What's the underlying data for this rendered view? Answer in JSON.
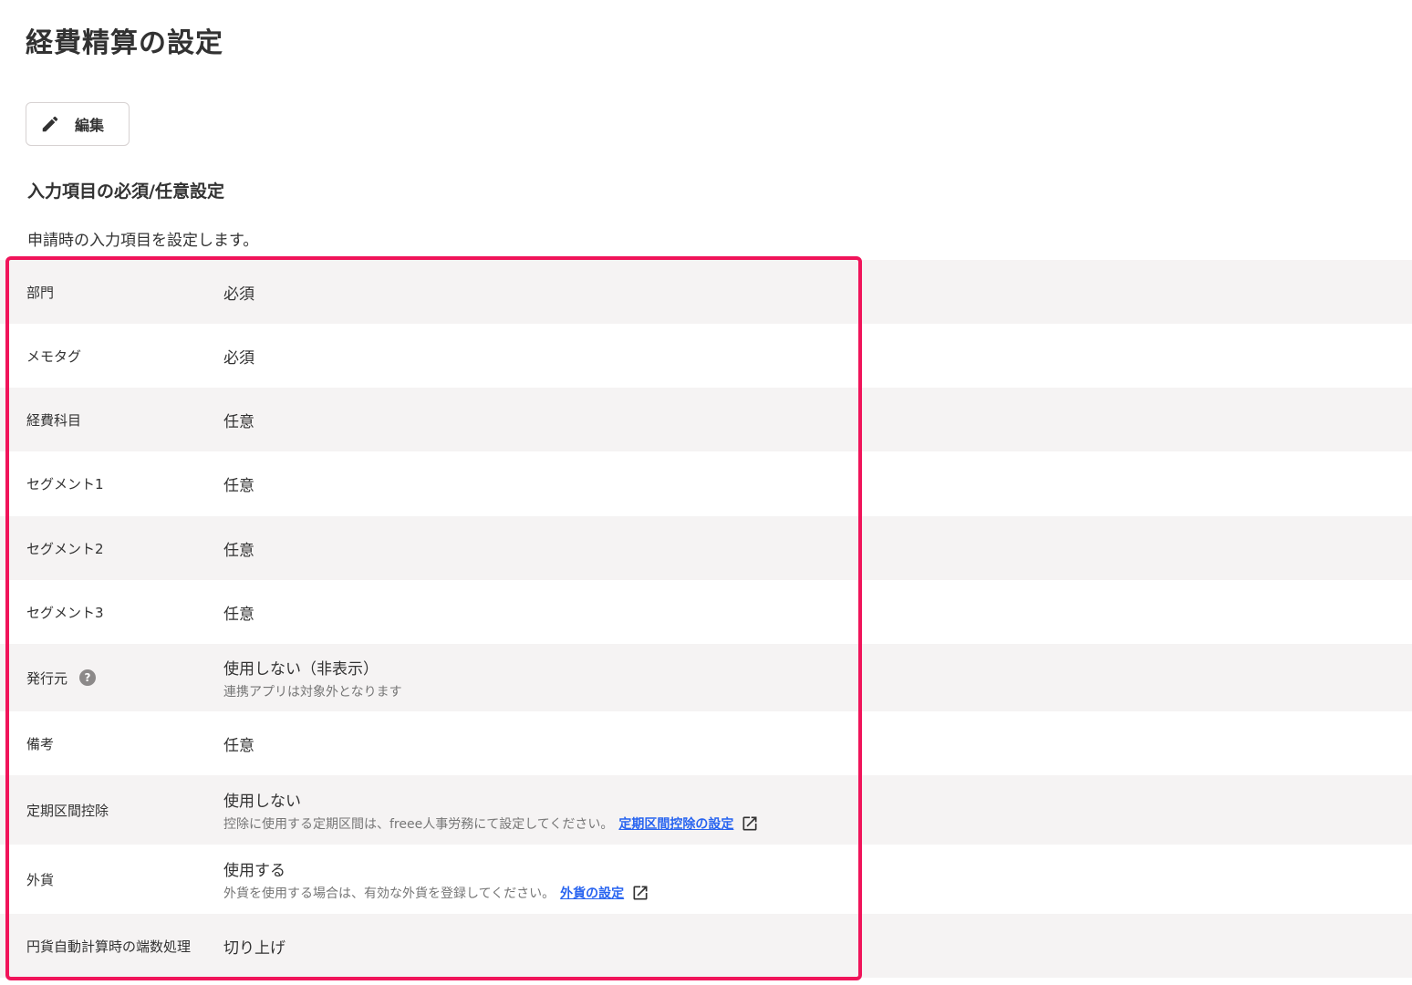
{
  "page_title": "経費精算の設定",
  "edit_button": {
    "label": "編集",
    "icon": "pencil-icon"
  },
  "section": {
    "title": "入力項目の必須/任意設定",
    "description": "申請時の入力項目を設定します。"
  },
  "rows": [
    {
      "label": "部門",
      "value": "必須"
    },
    {
      "label": "メモタグ",
      "value": "必須"
    },
    {
      "label": "経費科目",
      "value": "任意"
    },
    {
      "label": "セグメント1",
      "value": "任意"
    },
    {
      "label": "セグメント2",
      "value": "任意"
    },
    {
      "label": "セグメント3",
      "value": "任意"
    },
    {
      "label": "発行元",
      "value": "使用しない（非表示）",
      "sub": "連携アプリは対象外となります",
      "help_icon": "?"
    },
    {
      "label": "備考",
      "value": "任意"
    },
    {
      "label": "定期区間控除",
      "value": "使用しない",
      "sub": "控除に使用する定期区間は、freee人事労務にて設定してください。",
      "link": "定期区間控除の設定"
    },
    {
      "label": "外貨",
      "value": "使用する",
      "sub": "外貨を使用する場合は、有効な外貨を登録してください。",
      "link": "外貨の設定"
    },
    {
      "label": "円貨自動計算時の端数処理",
      "value": "切り上げ"
    }
  ],
  "colors": {
    "highlight_border": "#f0145a",
    "link": "#2864f0",
    "row_shade": "#f5f3f3"
  }
}
